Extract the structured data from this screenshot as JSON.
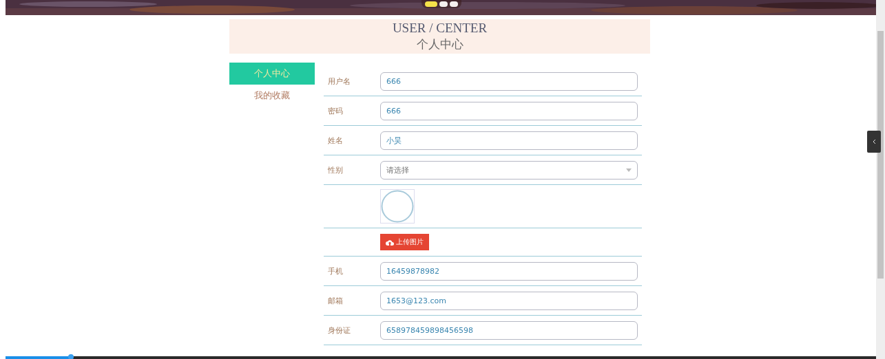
{
  "banner": {
    "dots": [
      {
        "selected": true
      },
      {
        "selected": false
      },
      {
        "selected": false
      }
    ]
  },
  "header": {
    "title_en": "USER / CENTER",
    "title_cn": "个人中心"
  },
  "sidebar": {
    "items": [
      {
        "label": "个人中心",
        "selected": true
      },
      {
        "label": "我的收藏",
        "selected": false
      }
    ]
  },
  "form": {
    "fields": [
      {
        "kind": "input",
        "label": "用户名",
        "value": "666"
      },
      {
        "kind": "input",
        "label": "密码",
        "value": "666"
      },
      {
        "kind": "input",
        "label": "姓名",
        "value": "小昊"
      },
      {
        "kind": "select",
        "label": "性别",
        "placeholder": "请选择"
      },
      {
        "kind": "avatar"
      },
      {
        "kind": "upload",
        "button": "上传图片"
      },
      {
        "kind": "input",
        "label": "手机",
        "value": "16459878982"
      },
      {
        "kind": "input",
        "label": "邮箱",
        "value": "1653@123.com"
      },
      {
        "kind": "input",
        "label": "身份证",
        "value": "658978459898456598"
      }
    ]
  },
  "player": {
    "level": 0.075
  }
}
